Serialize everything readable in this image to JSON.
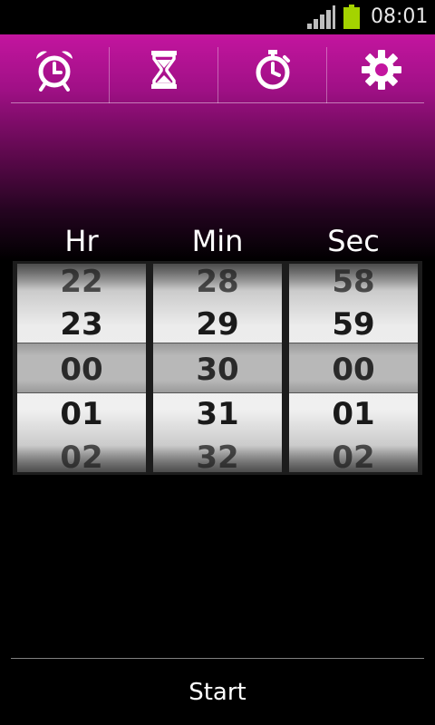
{
  "status_bar": {
    "time": "08:01",
    "icons": [
      "signal-icon",
      "battery-icon"
    ],
    "battery_color": "#a4d300"
  },
  "tabs": [
    {
      "icon": "alarm-clock-icon",
      "selected": false
    },
    {
      "icon": "hourglass-icon",
      "selected": true
    },
    {
      "icon": "stopwatch-icon",
      "selected": false
    },
    {
      "icon": "gear-icon",
      "selected": false
    }
  ],
  "colors": {
    "header_accent": "#c3159f",
    "background": "#000000"
  },
  "picker": {
    "hours": {
      "label": "Hr",
      "values": [
        "22",
        "23",
        "00",
        "01",
        "02"
      ]
    },
    "minutes": {
      "label": "Min",
      "values": [
        "28",
        "29",
        "30",
        "31",
        "32"
      ]
    },
    "seconds": {
      "label": "Sec",
      "values": [
        "58",
        "59",
        "00",
        "01",
        "02"
      ]
    }
  },
  "start_label": "Start"
}
